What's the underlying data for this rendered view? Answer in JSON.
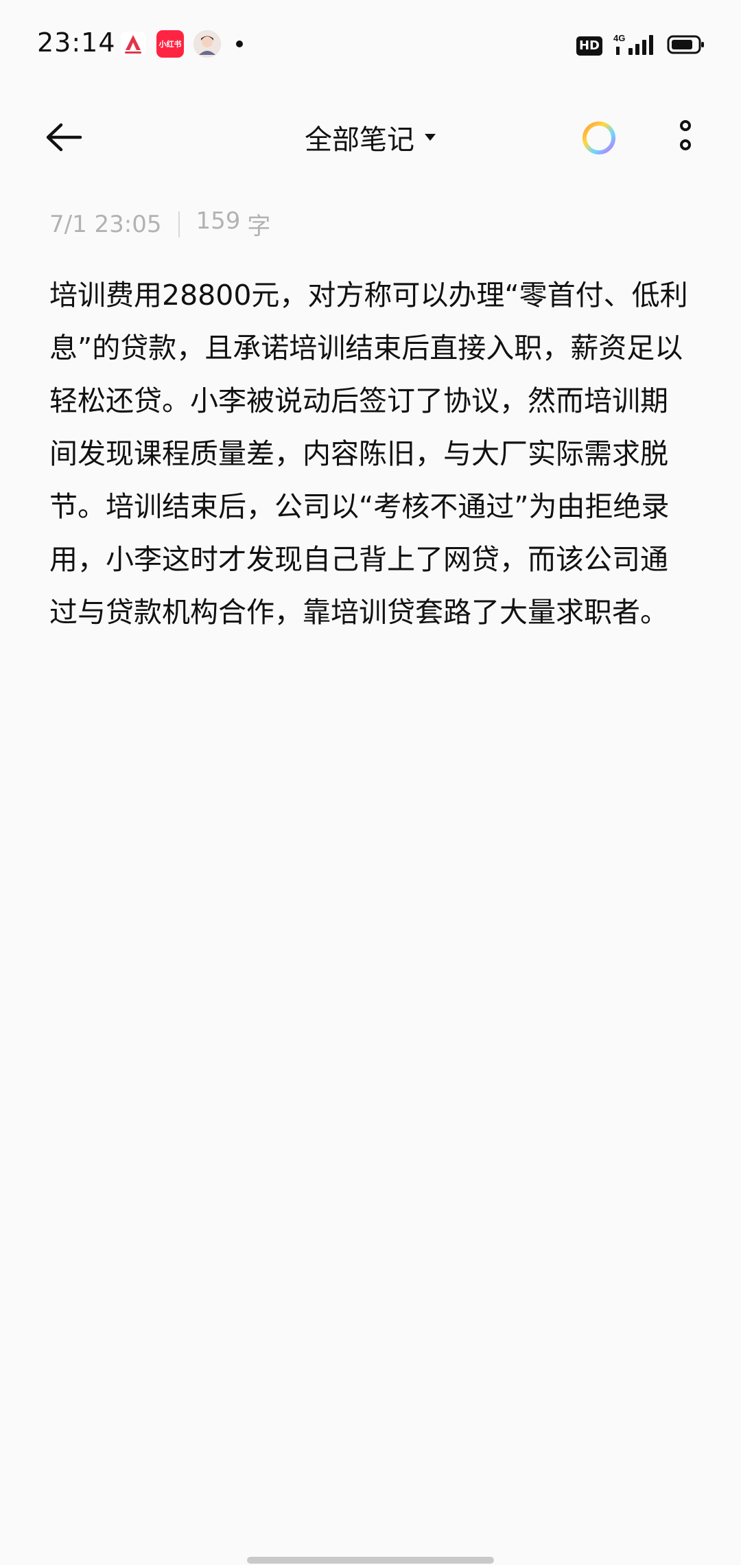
{
  "status_bar": {
    "time": "23:14",
    "redbook_label": "小红书",
    "hd_label": "HD",
    "network_label": "4G"
  },
  "toolbar": {
    "title": "全部笔记"
  },
  "note": {
    "date": "7/1 23:05",
    "word_count": "159",
    "word_unit": "字",
    "content": "培训费用28800元，对方称可以办理“零首付、低利息”的贷款，且承诺培训结束后直接入职，薪资足以轻松还贷。小李被说动后签订了协议，然而培训期间发现课程质量差，内容陈旧，与大厂实际需求脱节。培训结束后，公司以“考核不通过”为由拒绝录用，小李这时才发现自己背上了网贷，而该公司通过与贷款机构合作，靠培训贷套路了大量求职者。"
  },
  "icons": {
    "back": "arrow-left-icon",
    "dropdown": "caret-down-icon",
    "color_picker": "color-ring-icon",
    "more": "more-vertical-icon",
    "battery": "battery-icon",
    "signal": "signal-icon"
  }
}
